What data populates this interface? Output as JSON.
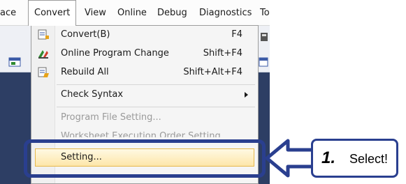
{
  "menubar": {
    "items": [
      "ace",
      "Convert",
      "View",
      "Online",
      "Debug",
      "Diagnostics",
      "To"
    ],
    "active_index": 1
  },
  "convert_menu": {
    "items": [
      {
        "label": "Convert(B)",
        "shortcut": "F4",
        "icon": "convert-icon",
        "enabled": true
      },
      {
        "label": "Online Program Change",
        "shortcut": "Shift+F4",
        "icon": "online-program-change-icon",
        "enabled": true
      },
      {
        "label": "Rebuild All",
        "shortcut": "Shift+Alt+F4",
        "icon": "rebuild-all-icon",
        "enabled": true
      },
      {
        "label": "Check Syntax",
        "shortcut": "",
        "icon": "",
        "enabled": true,
        "submenu": true
      },
      {
        "label": "Program File Setting...",
        "shortcut": "",
        "icon": "",
        "enabled": false
      },
      {
        "label": "Worksheet Execution Order Setting",
        "shortcut": "",
        "icon": "",
        "enabled": false
      },
      {
        "label": "Setting...",
        "shortcut": "",
        "icon": "",
        "enabled": true,
        "highlighted": true
      }
    ]
  },
  "callout": {
    "number": "1.",
    "text": "Select!"
  },
  "colors": {
    "highlight_border": "#2a3f8f",
    "menu_hover_fill": "#fde6a9",
    "workspace_bg": "#2d3e64"
  }
}
